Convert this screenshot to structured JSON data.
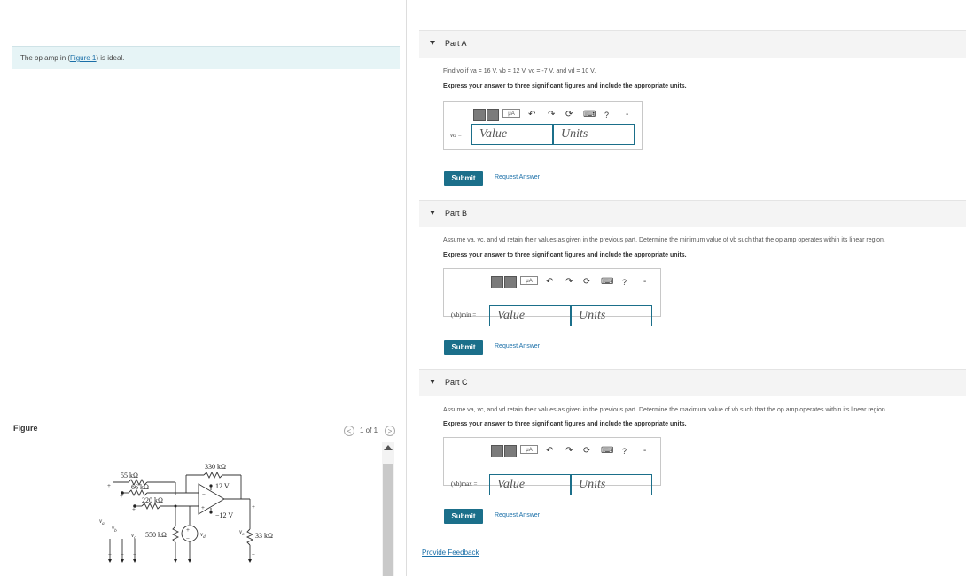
{
  "intro": {
    "before": "The op amp in (",
    "link": "Figure 1",
    "after": ") is ideal."
  },
  "figure": {
    "label": "Figure",
    "pager": "1 of 1",
    "prev": "<",
    "next": ">",
    "circuit_labels": {
      "r55": "55 kΩ",
      "r66": "66 kΩ",
      "r220": "220 kΩ",
      "r330": "330 kΩ",
      "r550": "550 kΩ",
      "r33": "33 kΩ",
      "vpos": "12 V",
      "vneg": "−12 V",
      "va": "v",
      "va_sub": "a",
      "vb": "v",
      "vb_sub": "b",
      "vc": "v",
      "vc_sub": "c",
      "vd": "v",
      "vd_sub": "d",
      "vo": "v",
      "vo_sub": "o"
    }
  },
  "partA": {
    "title": "Part A",
    "question": "Find vo if va = 16 V, vb = 12 V, vc = -7 V, and vd = 10 V.",
    "instructions": "Express your answer to three significant figures and include the appropriate units.",
    "var_label": "vo =",
    "value_placeholder": "Value",
    "units_placeholder": "Units",
    "submit": "Submit",
    "request": "Request Answer"
  },
  "partB": {
    "title": "Part B",
    "question": "Assume va, vc, and vd retain their values as given in the previous part. Determine the minimum value of vb such that the op amp operates within its linear region.",
    "instructions": "Express your answer to three significant figures and include the appropriate units.",
    "var_label": "(vb)min =",
    "value_placeholder": "Value",
    "units_placeholder": "Units",
    "submit": "Submit",
    "request": "Request Answer"
  },
  "partC": {
    "title": "Part C",
    "question": "Assume va, vc, and vd retain their values as given in the previous part. Determine the maximum value of vb such that the op amp operates within its linear region.",
    "instructions": "Express your answer to three significant figures and include the appropriate units.",
    "var_label": "(vb)max =",
    "value_placeholder": "Value",
    "units_placeholder": "Units",
    "submit": "Submit",
    "request": "Request Answer"
  },
  "toolbar": {
    "mu": "μA",
    "help": "?",
    "dash": "-"
  },
  "feedback": "Provide Feedback",
  "colors": {
    "accent": "#1b6f8a",
    "link": "#1a6fa8",
    "intro_bg": "#e6f4f6"
  }
}
